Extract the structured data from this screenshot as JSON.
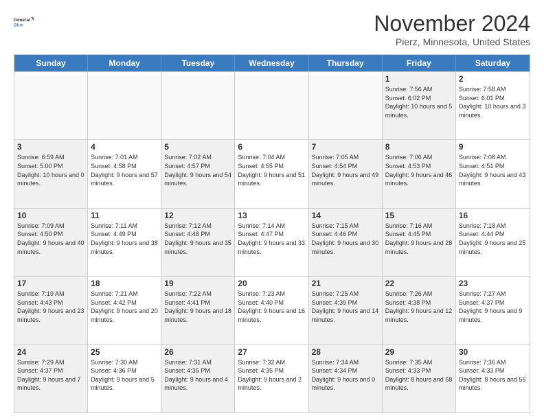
{
  "header": {
    "logo_line1": "General",
    "logo_line2": "Blue",
    "month": "November 2024",
    "location": "Pierz, Minnesota, United States"
  },
  "weekdays": [
    "Sunday",
    "Monday",
    "Tuesday",
    "Wednesday",
    "Thursday",
    "Friday",
    "Saturday"
  ],
  "weeks": [
    [
      {
        "day": "",
        "info": "",
        "empty": true
      },
      {
        "day": "",
        "info": "",
        "empty": true
      },
      {
        "day": "",
        "info": "",
        "empty": true
      },
      {
        "day": "",
        "info": "",
        "empty": true
      },
      {
        "day": "",
        "info": "",
        "empty": true
      },
      {
        "day": "1",
        "info": "Sunrise: 7:56 AM\nSunset: 6:02 PM\nDaylight: 10 hours\nand 5 minutes.",
        "shaded": true
      },
      {
        "day": "2",
        "info": "Sunrise: 7:58 AM\nSunset: 6:01 PM\nDaylight: 10 hours\nand 3 minutes."
      }
    ],
    [
      {
        "day": "3",
        "info": "Sunrise: 6:59 AM\nSunset: 5:00 PM\nDaylight: 10 hours\nand 0 minutes.",
        "shaded": true
      },
      {
        "day": "4",
        "info": "Sunrise: 7:01 AM\nSunset: 4:58 PM\nDaylight: 9 hours\nand 57 minutes."
      },
      {
        "day": "5",
        "info": "Sunrise: 7:02 AM\nSunset: 4:57 PM\nDaylight: 9 hours\nand 54 minutes.",
        "shaded": true
      },
      {
        "day": "6",
        "info": "Sunrise: 7:04 AM\nSunset: 4:55 PM\nDaylight: 9 hours\nand 51 minutes."
      },
      {
        "day": "7",
        "info": "Sunrise: 7:05 AM\nSunset: 4:54 PM\nDaylight: 9 hours\nand 49 minutes.",
        "shaded": true
      },
      {
        "day": "8",
        "info": "Sunrise: 7:06 AM\nSunset: 4:53 PM\nDaylight: 9 hours\nand 46 minutes.",
        "shaded": true
      },
      {
        "day": "9",
        "info": "Sunrise: 7:08 AM\nSunset: 4:51 PM\nDaylight: 9 hours\nand 43 minutes."
      }
    ],
    [
      {
        "day": "10",
        "info": "Sunrise: 7:09 AM\nSunset: 4:50 PM\nDaylight: 9 hours\nand 40 minutes.",
        "shaded": true
      },
      {
        "day": "11",
        "info": "Sunrise: 7:11 AM\nSunset: 4:49 PM\nDaylight: 9 hours\nand 38 minutes."
      },
      {
        "day": "12",
        "info": "Sunrise: 7:12 AM\nSunset: 4:48 PM\nDaylight: 9 hours\nand 35 minutes.",
        "shaded": true
      },
      {
        "day": "13",
        "info": "Sunrise: 7:14 AM\nSunset: 4:47 PM\nDaylight: 9 hours\nand 33 minutes."
      },
      {
        "day": "14",
        "info": "Sunrise: 7:15 AM\nSunset: 4:46 PM\nDaylight: 9 hours\nand 30 minutes.",
        "shaded": true
      },
      {
        "day": "15",
        "info": "Sunrise: 7:16 AM\nSunset: 4:45 PM\nDaylight: 9 hours\nand 28 minutes.",
        "shaded": true
      },
      {
        "day": "16",
        "info": "Sunrise: 7:18 AM\nSunset: 4:44 PM\nDaylight: 9 hours\nand 25 minutes."
      }
    ],
    [
      {
        "day": "17",
        "info": "Sunrise: 7:19 AM\nSunset: 4:43 PM\nDaylight: 9 hours\nand 23 minutes.",
        "shaded": true
      },
      {
        "day": "18",
        "info": "Sunrise: 7:21 AM\nSunset: 4:42 PM\nDaylight: 9 hours\nand 20 minutes."
      },
      {
        "day": "19",
        "info": "Sunrise: 7:22 AM\nSunset: 4:41 PM\nDaylight: 9 hours\nand 18 minutes.",
        "shaded": true
      },
      {
        "day": "20",
        "info": "Sunrise: 7:23 AM\nSunset: 4:40 PM\nDaylight: 9 hours\nand 16 minutes."
      },
      {
        "day": "21",
        "info": "Sunrise: 7:25 AM\nSunset: 4:39 PM\nDaylight: 9 hours\nand 14 minutes.",
        "shaded": true
      },
      {
        "day": "22",
        "info": "Sunrise: 7:26 AM\nSunset: 4:38 PM\nDaylight: 9 hours\nand 12 minutes.",
        "shaded": true
      },
      {
        "day": "23",
        "info": "Sunrise: 7:27 AM\nSunset: 4:37 PM\nDaylight: 9 hours\nand 9 minutes."
      }
    ],
    [
      {
        "day": "24",
        "info": "Sunrise: 7:29 AM\nSunset: 4:37 PM\nDaylight: 9 hours\nand 7 minutes.",
        "shaded": true
      },
      {
        "day": "25",
        "info": "Sunrise: 7:30 AM\nSunset: 4:36 PM\nDaylight: 9 hours\nand 5 minutes."
      },
      {
        "day": "26",
        "info": "Sunrise: 7:31 AM\nSunset: 4:35 PM\nDaylight: 9 hours\nand 4 minutes.",
        "shaded": true
      },
      {
        "day": "27",
        "info": "Sunrise: 7:32 AM\nSunset: 4:35 PM\nDaylight: 9 hours\nand 2 minutes."
      },
      {
        "day": "28",
        "info": "Sunrise: 7:34 AM\nSunset: 4:34 PM\nDaylight: 9 hours\nand 0 minutes.",
        "shaded": true
      },
      {
        "day": "29",
        "info": "Sunrise: 7:35 AM\nSunset: 4:33 PM\nDaylight: 8 hours\nand 58 minutes.",
        "shaded": true
      },
      {
        "day": "30",
        "info": "Sunrise: 7:36 AM\nSunset: 4:33 PM\nDaylight: 8 hours\nand 56 minutes."
      }
    ]
  ]
}
